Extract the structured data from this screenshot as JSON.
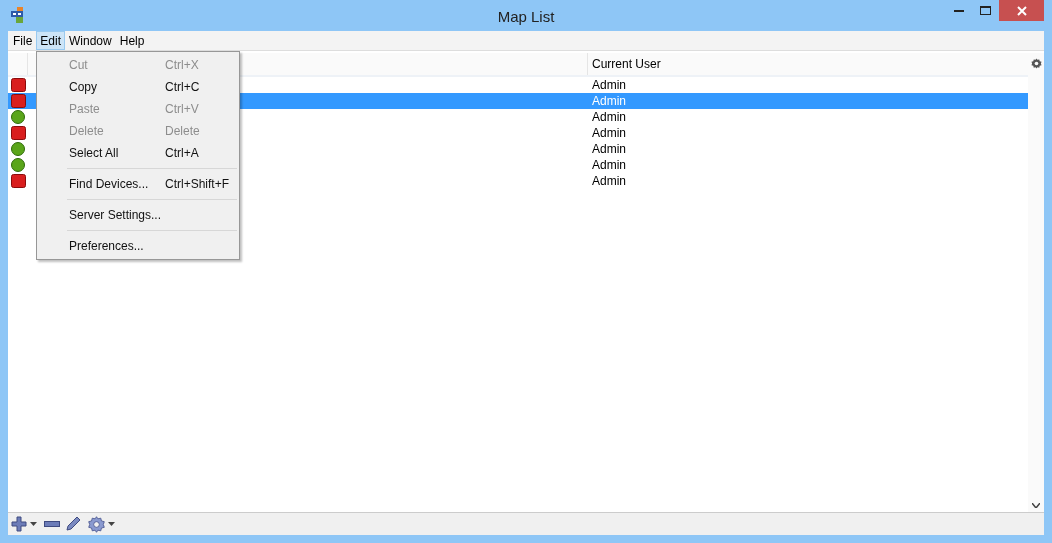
{
  "window": {
    "title": "Map List"
  },
  "menu_bar": [
    {
      "label": "File",
      "selected": false
    },
    {
      "label": "Edit",
      "selected": true
    },
    {
      "label": "Window",
      "selected": false
    },
    {
      "label": "Help",
      "selected": false
    }
  ],
  "edit_menu": [
    {
      "kind": "item",
      "label": "Cut",
      "shortcut": "Ctrl+X",
      "disabled": true
    },
    {
      "kind": "item",
      "label": "Copy",
      "shortcut": "Ctrl+C",
      "disabled": false
    },
    {
      "kind": "item",
      "label": "Paste",
      "shortcut": "Ctrl+V",
      "disabled": true
    },
    {
      "kind": "item",
      "label": "Delete",
      "shortcut": "Delete",
      "disabled": true
    },
    {
      "kind": "item",
      "label": "Select All",
      "shortcut": "Ctrl+A",
      "disabled": false
    },
    {
      "kind": "separator"
    },
    {
      "kind": "item",
      "label": "Find Devices...",
      "shortcut": "Ctrl+Shift+F",
      "disabled": false
    },
    {
      "kind": "separator"
    },
    {
      "kind": "item",
      "label": "Server Settings...",
      "disabled": false
    },
    {
      "kind": "separator"
    },
    {
      "kind": "item",
      "label": "Preferences...",
      "disabled": false
    }
  ],
  "table": {
    "columns": [
      "Current User"
    ],
    "rows": [
      {
        "running": false,
        "current_user": "Admin",
        "selected": false
      },
      {
        "running": false,
        "current_user": "Admin",
        "selected": true
      },
      {
        "running": true,
        "current_user": "Admin",
        "selected": false
      },
      {
        "running": false,
        "current_user": "Admin",
        "selected": false
      },
      {
        "running": true,
        "current_user": "Admin",
        "selected": false
      },
      {
        "running": true,
        "current_user": "Admin",
        "selected": false
      },
      {
        "running": false,
        "current_user": "Admin",
        "selected": false
      }
    ]
  }
}
